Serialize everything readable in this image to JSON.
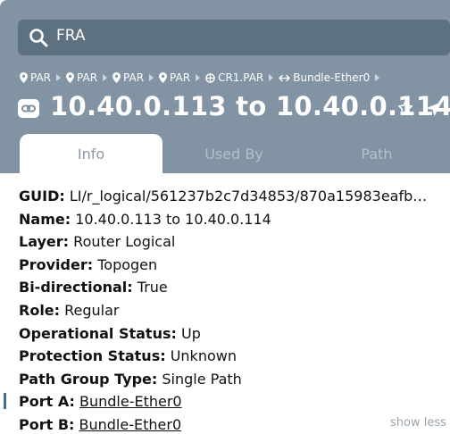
{
  "search": {
    "value": "FRA"
  },
  "breadcrumb": [
    {
      "label": "PAR",
      "icon": "location-pin-icon"
    },
    {
      "label": "PAR",
      "icon": "location-pin-icon"
    },
    {
      "label": "PAR",
      "icon": "location-pin-icon"
    },
    {
      "label": "PAR",
      "icon": "location-pin-icon"
    },
    {
      "label": "CR1.PAR",
      "icon": "router-icon"
    },
    {
      "label": "Bundle-Ether0",
      "icon": "link-arrows-icon"
    }
  ],
  "title": {
    "text": "10.40.0.113 to 10.40.0.114",
    "icon": "link-icon"
  },
  "tabs": [
    {
      "label": "Info",
      "active": true
    },
    {
      "label": "Used By",
      "active": false
    },
    {
      "label": "Path",
      "active": false
    }
  ],
  "details": [
    {
      "key": "GUID:",
      "value": "LI/r_logical/561237b2c7d34853/870a15983eafb…"
    },
    {
      "key": "Name:",
      "value": "10.40.0.113 to 10.40.0.114"
    },
    {
      "key": "Layer:",
      "value": "Router Logical"
    },
    {
      "key": "Provider:",
      "value": "Topogen"
    },
    {
      "key": "Bi-directional:",
      "value": "True"
    },
    {
      "key": "Role:",
      "value": "Regular"
    },
    {
      "key": "Operational Status:",
      "value": "Up"
    },
    {
      "key": "Protection Status:",
      "value": "Unknown"
    },
    {
      "key": "Path Group Type:",
      "value": "Single Path"
    },
    {
      "key": "Port A:",
      "value": "Bundle-Ether0"
    },
    {
      "key": "Port B:",
      "value": "Bundle-Ether0"
    }
  ],
  "show_less": "show less",
  "colors": {
    "header_bg": "#8294a3",
    "search_bg": "#5e7180",
    "text": "#111111",
    "muted": "#9aa4ad"
  }
}
